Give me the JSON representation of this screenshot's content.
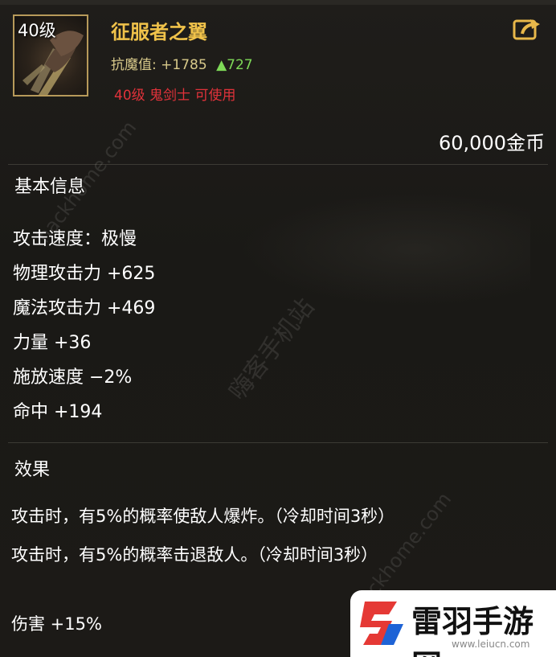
{
  "item": {
    "level_tag": "40级",
    "name": "征服者之翼",
    "stat_label": "抗魔值:",
    "stat_value": "+1785",
    "stat_delta": "▲727",
    "requirement": "40级 鬼剑士 可使用",
    "price": "60,000金币"
  },
  "basic_info": {
    "title": "基本信息",
    "stats": [
      "攻击速度：极慢",
      "物理攻击力 +625",
      "魔法攻击力 +469",
      "力量 +36",
      "施放速度 −2%",
      "命中 +194"
    ]
  },
  "effects": {
    "title": "效果",
    "lines": [
      "攻击时，有5%的概率使敌人爆炸。（冷却时间3秒）",
      "攻击时，有5%的概率击退敌人。（冷却时间3秒）",
      "伤害 +15%"
    ]
  },
  "watermark": {
    "cn": "嗨客手机站",
    "domain_1": "hackhome.com",
    "domain_2": "hackhome.com"
  },
  "logo": {
    "text": "雷羽手游网",
    "url": "www.leiucn.com"
  },
  "colors": {
    "item_name": "#f0c24a",
    "requirement": "#e0323a",
    "stat_up": "#7ed957",
    "icon_border": "#b79a5a"
  }
}
